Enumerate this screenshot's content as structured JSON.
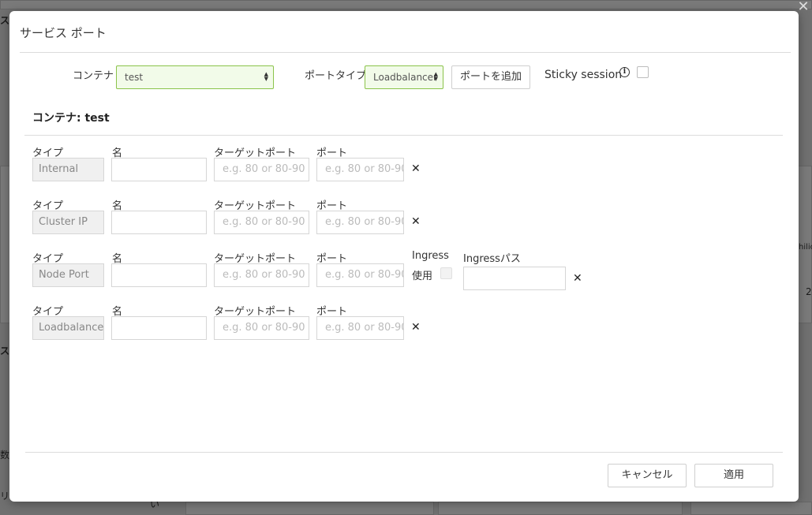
{
  "dialog": {
    "title": "サービス ポート",
    "close_icon": "✕"
  },
  "toolbar": {
    "container_label": "コンテナ :",
    "container_value": "test",
    "port_type_label": "ポートタイプ :",
    "port_type_value": "Loadbalancer",
    "add_port_label": "ポートを追加",
    "sticky_label": "Sticky session",
    "sticky_checked": false
  },
  "section": {
    "title": "コンテナ: test"
  },
  "columns": {
    "type": "タイプ",
    "name": "名",
    "target_port": "ターゲットポート",
    "port": "ポート",
    "ingress": "Ingress",
    "ingress_use": "使用",
    "ingress_path": "Ingressパス"
  },
  "placeholders": {
    "port": "e.g. 80 or 80-90"
  },
  "rows": [
    {
      "type": "Internal",
      "name": "",
      "target_port": "",
      "port": ""
    },
    {
      "type": "Cluster IP",
      "name": "",
      "target_port": "",
      "port": ""
    },
    {
      "type": "Node Port",
      "name": "",
      "target_port": "",
      "port": "",
      "ingress_path": ""
    },
    {
      "type": "Loadbalancer",
      "name": "",
      "target_port": "",
      "port": ""
    }
  ],
  "remove_icon": "✕",
  "footer": {
    "cancel_label": "キャンセル",
    "apply_label": "適用"
  },
  "background": {
    "texts": [
      "ス",
      "ス",
      "数",
      "リス",
      "い",
      "hilic",
      "2"
    ]
  },
  "colors": {
    "accent_border": "#8bc34a",
    "accent_fill": "#f2fbe9"
  }
}
